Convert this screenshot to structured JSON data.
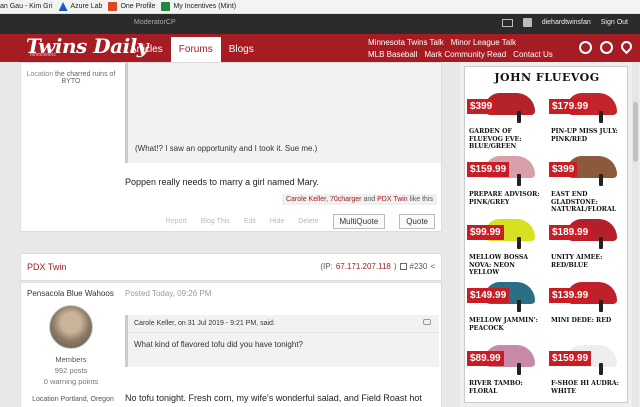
{
  "bookmarks": [
    {
      "label": "an Gau - Kim Gri",
      "icon": "page-icon"
    },
    {
      "label": "Azure Lab",
      "icon": "azure-icon"
    },
    {
      "label": "One Profile",
      "icon": "office-icon"
    },
    {
      "label": "My Incentives (Mint)",
      "icon": "green-icon"
    }
  ],
  "topbar": {
    "modcp": "ModeratorCP",
    "username": "diehardtwinsfan",
    "signout": "Sign Out"
  },
  "header": {
    "logo": "Twins Daily",
    "logo_sub": "mnmcentric",
    "nav": [
      "Articles",
      "Forums",
      "Blogs"
    ],
    "active_nav": "Forums",
    "links_row1": [
      "Minnesota Twins Talk",
      "Minor League Talk"
    ],
    "links_row2": [
      "MLB Baseball",
      "Mark Community Read",
      "Contact Us"
    ]
  },
  "post1": {
    "location_label": "Location",
    "location_value": "the charred ruins of BYTO",
    "quote_text": "(What!? I saw an opportunity and I took it. Sue me.)",
    "body": "Poppen really needs to marry a girl named Mary.",
    "likes": {
      "name1": "Carole Keller",
      "sep": ",",
      "name2": "70charger",
      "and": "and",
      "name3": "PDX Twin",
      "suffix": "like this"
    },
    "actions": [
      "Report",
      "Blog This",
      "Edit",
      "Hide",
      "Delete"
    ],
    "multiquote": "MultiQuote",
    "quote_btn": "Quote"
  },
  "post2": {
    "author": "PDX Twin",
    "ip_label": "(IP:",
    "ip": "67.171.207.118",
    "ip_close": ")",
    "post_no": "#230",
    "team": "Pensacola Blue Wahoos",
    "posted": "Posted Today, 09:26 PM",
    "role": "Members",
    "posts": "992 posts",
    "warnings": "0 warning points",
    "location_label": "Location",
    "location_value": "Portland, Oregon",
    "quote_head": "Carole Keller, on 31 Jul 2019 - 9:21 PM, said:",
    "quote_text": "What kind of flavored tofu did you have tonight?",
    "body": "No tofu tonight. Fresh corn, my wife's wonderful salad, and Field Roast hot"
  },
  "ad": {
    "brand": "JOHN FLUEVOG",
    "items": [
      {
        "price": "$399",
        "name": "Garden of Fluevog Eve: Blue/Green",
        "color": "#b5232a"
      },
      {
        "price": "$179.99",
        "name": "Pin-Up Miss July: Pink/Red",
        "color": "#c2262c"
      },
      {
        "price": "$159.99",
        "name": "Prepare Advisor: Pink/Grey",
        "color": "#d8a0a8"
      },
      {
        "price": "$399",
        "name": "East End Gladstone: Natural/Floral",
        "color": "#8a5a3a"
      },
      {
        "price": "$99.99",
        "name": "Mellow Bossa Nova: Neon Yellow",
        "color": "#d7e021"
      },
      {
        "price": "$189.99",
        "name": "Unity Aimee: Red/Blue",
        "color": "#b51f2a"
      },
      {
        "price": "$149.99",
        "name": "Mellow Jammin': Peacock",
        "color": "#2a6f86"
      },
      {
        "price": "$139.99",
        "name": "Mini Dede: Red",
        "color": "#c0202a"
      },
      {
        "price": "$89.99",
        "name": "River Tambo: Floral",
        "color": "#c98aa8"
      },
      {
        "price": "$159.99",
        "name": "F-Shoe Hi Audra: White",
        "color": "#eeeeee"
      }
    ]
  }
}
